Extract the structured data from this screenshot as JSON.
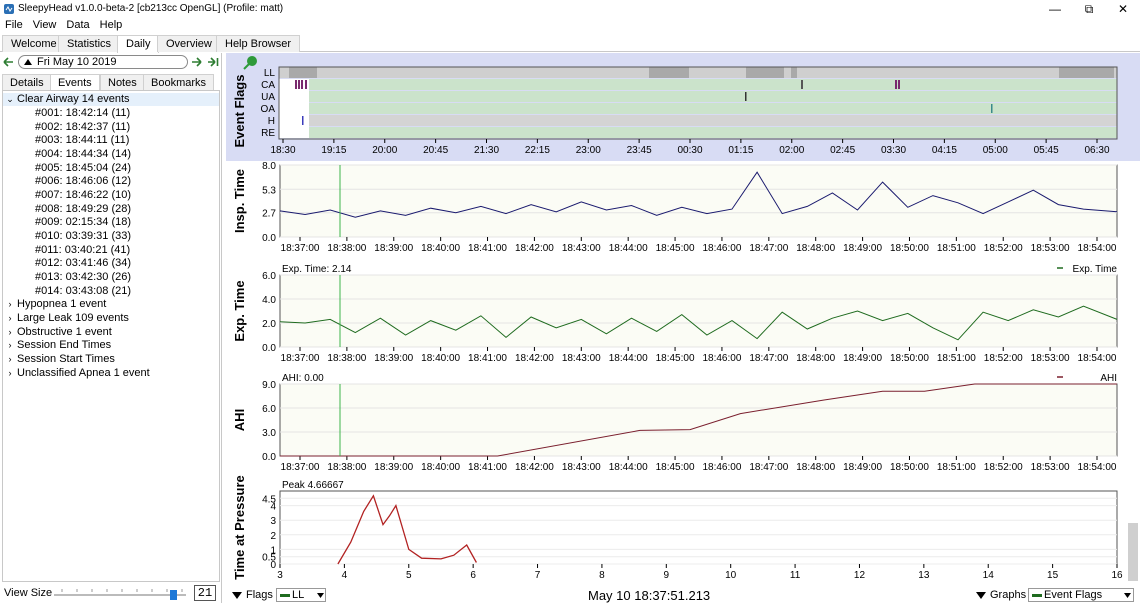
{
  "window": {
    "title": "SleepyHead v1.0.0-beta-2 [cb213cc OpenGL] (Profile: matt)",
    "minimize": "—",
    "maximize": "⧉",
    "close": "✕"
  },
  "menu": [
    "File",
    "View",
    "Data",
    "Help"
  ],
  "top_tabs": [
    "Welcome",
    "Statistics",
    "Daily",
    "Overview",
    "Help Browser"
  ],
  "date": "Fri May 10 2019",
  "sub_tabs": [
    "Details",
    "Events",
    "Notes",
    "Bookmarks"
  ],
  "tree": {
    "expanded_group": "Clear Airway 14 events",
    "events": [
      "#001: 18:42:14 (11)",
      "#002: 18:42:37 (11)",
      "#003: 18:44:11 (11)",
      "#004: 18:44:34 (14)",
      "#005: 18:45:04 (24)",
      "#006: 18:46:06 (12)",
      "#007: 18:46:22 (10)",
      "#008: 18:49:29 (28)",
      "#009: 02:15:34 (18)",
      "#010: 03:39:31 (33)",
      "#011: 03:40:21 (41)",
      "#012: 03:41:46 (34)",
      "#013: 03:42:30 (26)",
      "#014: 03:43:08 (21)"
    ],
    "groups": [
      "Hypopnea 1 event",
      "Large Leak 109 events",
      "Obstructive 1 event",
      "Session End Times",
      "Session Start Times",
      "Unclassified Apnea 1 event"
    ]
  },
  "view_size": {
    "label": "View Size",
    "value": "21"
  },
  "flags_chart": {
    "ylabel": "Event Flags",
    "rows": [
      "LL",
      "CA",
      "UA",
      "OA",
      "H",
      "RE"
    ],
    "ticks": [
      "18:30",
      "19:15",
      "20:00",
      "20:45",
      "21:30",
      "22:15",
      "23:00",
      "23:45",
      "00:30",
      "01:15",
      "02:00",
      "02:45",
      "03:30",
      "04:15",
      "05:00",
      "05:45",
      "06:30"
    ]
  },
  "time_ticks": [
    "18:37:00",
    "18:38:00",
    "18:39:00",
    "18:40:00",
    "18:41:00",
    "18:42:00",
    "18:43:00",
    "18:44:00",
    "18:45:00",
    "18:46:00",
    "18:47:00",
    "18:48:00",
    "18:49:00",
    "18:50:00",
    "18:51:00",
    "18:52:00",
    "18:53:00",
    "18:54:00"
  ],
  "chart_data": [
    {
      "type": "line",
      "ylabel": "Insp. Time",
      "yticks": [
        "8.0",
        "5.3",
        "2.7",
        "0.0"
      ],
      "ylim": [
        0,
        8
      ],
      "color": "#1a1a6e",
      "x": [
        0,
        0.03,
        0.06,
        0.09,
        0.12,
        0.15,
        0.18,
        0.21,
        0.24,
        0.27,
        0.3,
        0.33,
        0.36,
        0.39,
        0.42,
        0.45,
        0.48,
        0.51,
        0.54,
        0.57,
        0.6,
        0.63,
        0.66,
        0.69,
        0.72,
        0.75,
        0.78,
        0.81,
        0.84,
        0.87,
        0.9,
        0.93,
        0.96,
        1.0
      ],
      "values": [
        2.9,
        2.5,
        3.0,
        2.2,
        2.9,
        2.4,
        3.2,
        2.7,
        3.4,
        2.6,
        3.6,
        2.8,
        3.9,
        3.0,
        3.5,
        2.4,
        3.3,
        2.6,
        3.1,
        7.2,
        2.6,
        3.4,
        4.9,
        3.0,
        6.1,
        3.3,
        4.6,
        3.8,
        2.6,
        3.9,
        5.2,
        3.6,
        3.1,
        2.8
      ],
      "marker_label": ""
    },
    {
      "type": "line",
      "ylabel": "Exp. Time",
      "yticks": [
        "6.0",
        "4.0",
        "2.0",
        "0.0"
      ],
      "ylim": [
        0,
        6
      ],
      "color": "#1f6b1f",
      "legend": "Exp. Time",
      "marker_label": "Exp. Time: 2.14",
      "x": [
        0,
        0.03,
        0.06,
        0.09,
        0.12,
        0.15,
        0.18,
        0.21,
        0.24,
        0.27,
        0.3,
        0.33,
        0.36,
        0.39,
        0.42,
        0.45,
        0.48,
        0.51,
        0.54,
        0.57,
        0.6,
        0.63,
        0.66,
        0.69,
        0.72,
        0.75,
        0.78,
        0.81,
        0.84,
        0.87,
        0.9,
        0.93,
        0.96,
        1.0
      ],
      "values": [
        2.1,
        2.0,
        2.3,
        1.2,
        2.4,
        1.0,
        2.2,
        1.4,
        2.6,
        0.8,
        2.5,
        1.6,
        2.3,
        1.1,
        2.4,
        1.3,
        2.7,
        1.0,
        2.2,
        0.7,
        2.9,
        1.5,
        2.4,
        3.0,
        2.2,
        2.8,
        1.6,
        0.6,
        2.9,
        2.2,
        3.1,
        2.5,
        3.4,
        2.3
      ]
    },
    {
      "type": "line",
      "ylabel": "AHI",
      "yticks": [
        "9.0",
        "6.0",
        "3.0",
        "0.0"
      ],
      "ylim": [
        0,
        9
      ],
      "color": "#7a1f2e",
      "legend": "AHI",
      "marker_label": "AHI: 0.00",
      "x": [
        0,
        0.26,
        0.43,
        0.49,
        0.55,
        0.65,
        0.72,
        0.77,
        0.83,
        1.0
      ],
      "values": [
        0,
        0,
        3.2,
        3.3,
        5.3,
        7.0,
        8.1,
        8.1,
        9.0,
        9.0
      ]
    },
    {
      "type": "line",
      "ylabel": "Time at Pressure",
      "marker_label": "Peak 4.66667",
      "yticks": [
        "4.5",
        "4",
        "3",
        "2",
        "1",
        "0.5",
        "0"
      ],
      "ylim": [
        0,
        5
      ],
      "xticks": [
        "3",
        "4",
        "5",
        "6",
        "7",
        "8",
        "9",
        "10",
        "11",
        "12",
        "13",
        "14",
        "15",
        "16"
      ],
      "xlim": [
        3,
        16
      ],
      "color": "#b22222",
      "x": [
        3.9,
        4.1,
        4.3,
        4.45,
        4.6,
        4.7,
        4.8,
        5.0,
        5.2,
        5.5,
        5.7,
        5.9,
        6.05
      ],
      "values": [
        0,
        1.5,
        3.6,
        4.67,
        2.7,
        3.3,
        4.0,
        1.0,
        0.4,
        0.35,
        0.6,
        1.3,
        0.1
      ]
    }
  ],
  "bottom": {
    "flags_label": "Flags",
    "flags_select": "LL",
    "timestamp": "May 10 18:37:51.213",
    "graphs_label": "Graphs",
    "graphs_select": "Event Flags"
  }
}
